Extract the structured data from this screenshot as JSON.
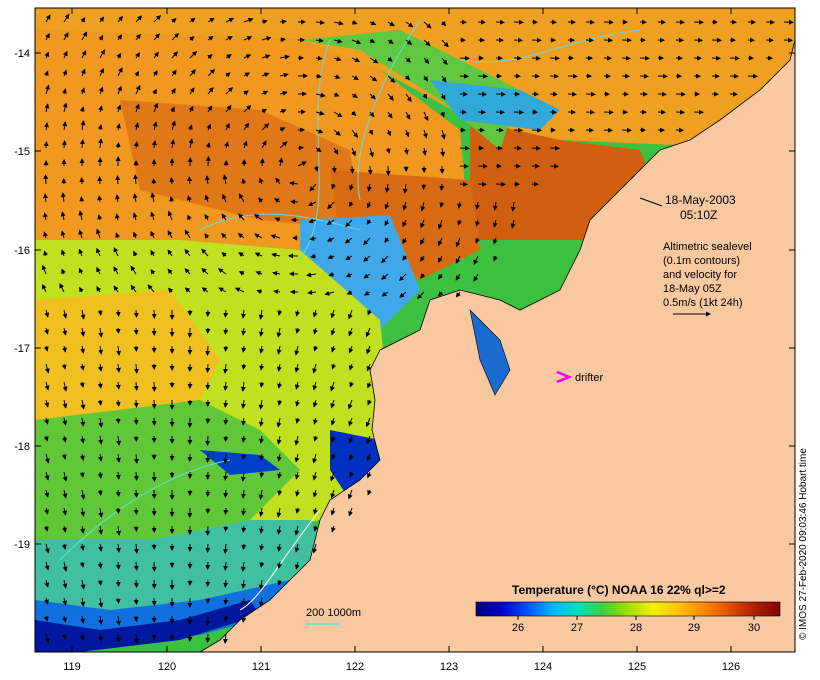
{
  "map": {
    "lat_ticks": [
      "-14",
      "-15",
      "-16",
      "-17",
      "-18",
      "-19"
    ],
    "lon_ticks": [
      "119",
      "120",
      "121",
      "122",
      "123",
      "124",
      "125",
      "126"
    ],
    "date": "18-May-2003",
    "time": "05:10Z",
    "legend_lines": [
      "Altimetric sealevel",
      "(0.1m contours)",
      "and velocity for",
      "18-May 05Z",
      "0.5m/s (1kt 24h)"
    ],
    "drifter_label": "drifter",
    "depth_label": "200  1000m",
    "credit": "© IMOS 27-Feb-2020 09:03:46 Hobart time"
  },
  "colorbar": {
    "title": "Temperature (°C) NOAA 16 22% ql>=2",
    "ticks": [
      "26",
      "27",
      "28",
      "29",
      "30"
    ],
    "colors": [
      "#000080",
      "#0000c8",
      "#0050ff",
      "#00b4ff",
      "#00e0c0",
      "#40d040",
      "#a0e000",
      "#f0f000",
      "#ffc000",
      "#ff8800",
      "#e05000",
      "#b02000",
      "#800000"
    ]
  },
  "colors": {
    "land": "#f8c8a0",
    "drifter": "#ff00ff",
    "contour": "#60e0e0"
  }
}
